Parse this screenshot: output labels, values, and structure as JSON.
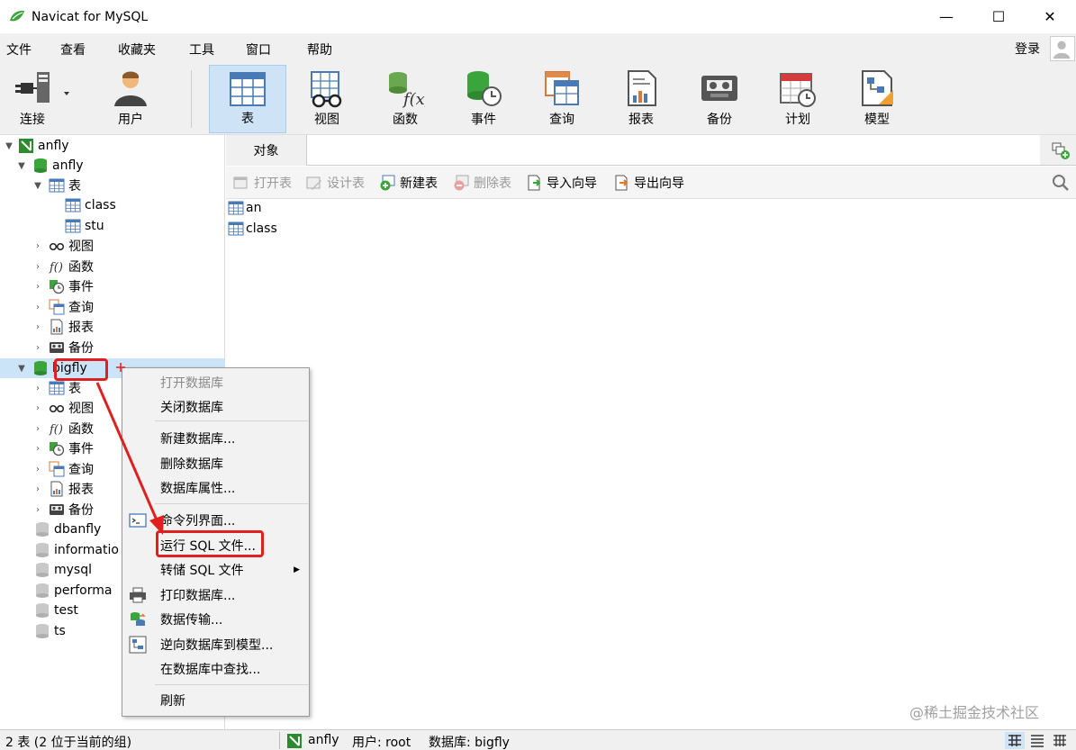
{
  "window": {
    "title": "Navicat for MySQL",
    "minimize": "—",
    "maximize": "☐",
    "close": "✕"
  },
  "menu": {
    "items": [
      "文件",
      "查看",
      "收藏夹",
      "工具",
      "窗口",
      "帮助"
    ],
    "login": "登录"
  },
  "toolbar": {
    "items": [
      {
        "label": "连接",
        "icon": "plug-icon"
      },
      {
        "label": "用户",
        "icon": "user-icon"
      },
      {
        "label": "表",
        "icon": "table-icon",
        "selected": true
      },
      {
        "label": "视图",
        "icon": "view-glasses-icon"
      },
      {
        "label": "函数",
        "icon": "function-icon"
      },
      {
        "label": "事件",
        "icon": "event-clock-icon"
      },
      {
        "label": "查询",
        "icon": "query-icon"
      },
      {
        "label": "报表",
        "icon": "report-icon"
      },
      {
        "label": "备份",
        "icon": "backup-tape-icon"
      },
      {
        "label": "计划",
        "icon": "schedule-calendar-icon"
      },
      {
        "label": "模型",
        "icon": "model-icon"
      }
    ]
  },
  "tree": {
    "connection": "anfly",
    "db_anfly": "anfly",
    "tables_label": "表",
    "tables": [
      "class",
      "stu"
    ],
    "views_label": "视图",
    "functions_label": "函数",
    "events_label": "事件",
    "queries_label": "查询",
    "reports_label": "报表",
    "backups_label": "备份",
    "db_bigfly": "bigfly",
    "other_dbs": [
      "dbanfly",
      "informatio",
      "mysql",
      "performa",
      "test",
      "ts"
    ]
  },
  "objects": {
    "tab": "对象",
    "actions": [
      {
        "label": "打开表",
        "disabled": true
      },
      {
        "label": "设计表",
        "disabled": true
      },
      {
        "label": "新建表",
        "disabled": false
      },
      {
        "label": "删除表",
        "disabled": true
      },
      {
        "label": "导入向导",
        "disabled": false
      },
      {
        "label": "导出向导",
        "disabled": false
      }
    ],
    "items": [
      "an",
      "class"
    ]
  },
  "context_menu": {
    "items": [
      {
        "label": "打开数据库",
        "disabled": true
      },
      {
        "label": "关闭数据库"
      },
      {
        "label": "新建数据库..."
      },
      {
        "label": "删除数据库"
      },
      {
        "label": "数据库属性..."
      },
      {
        "label": "命令列界面..."
      },
      {
        "label": "运行 SQL 文件..."
      },
      {
        "label": "转储 SQL 文件"
      },
      {
        "label": "打印数据库..."
      },
      {
        "label": "数据传输..."
      },
      {
        "label": "逆向数据库到模型..."
      },
      {
        "label": "在数据库中查找..."
      },
      {
        "label": "刷新"
      }
    ]
  },
  "status": {
    "left": "2 表 (2 位于当前的组)",
    "connection": "anfly",
    "user": "用户: root",
    "database": "数据库: bigfly"
  },
  "watermark": "@稀土掘金技术社区",
  "colors": {
    "accent": "#3a9a3a",
    "highlight": "#e02020",
    "selected_bg": "#cfe3f7"
  }
}
